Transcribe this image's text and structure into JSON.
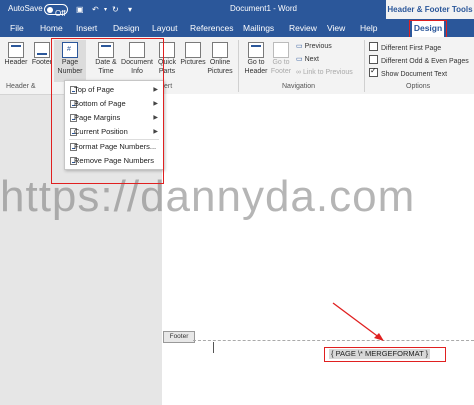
{
  "titlebar": {
    "autosave_label": "AutoSave",
    "autosave_state": "Off",
    "document_title": "Document1 - Word",
    "context_group": "Header & Footer Tools"
  },
  "tabs": [
    "File",
    "Home",
    "Insert",
    "Design",
    "Layout",
    "References",
    "Mailings",
    "Review",
    "View",
    "Help"
  ],
  "active_tab": "Design",
  "ribbon": {
    "header": "Header",
    "footer": "Footer",
    "page_number_line1": "Page",
    "page_number_line2": "Number",
    "group_header_footer": "Header &",
    "date_time_line1": "Date &",
    "date_time_line2": "Time",
    "doc_info_line1": "Document",
    "doc_info_line2": "Info",
    "quick_parts_line1": "Quick",
    "quick_parts_line2": "Parts",
    "pictures": "Pictures",
    "online_pictures_line1": "Online",
    "online_pictures_line2": "Pictures",
    "group_insert_fragment": "ert",
    "go_to_header_line1": "Go to",
    "go_to_header_line2": "Header",
    "go_to_footer_line1": "Go to",
    "go_to_footer_line2": "Footer",
    "previous": "Previous",
    "next": "Next",
    "link_previous": "Link to Previous",
    "group_navigation": "Navigation",
    "different_first_page": "Different First Page",
    "different_odd_even": "Different Odd & Even Pages",
    "show_document_text": "Show Document Text",
    "group_options": "Options"
  },
  "menu": {
    "items": [
      "Top of Page",
      "Bottom of Page",
      "Page Margins",
      "Current Position",
      "Format Page Numbers...",
      "Remove Page Numbers"
    ]
  },
  "document": {
    "watermark": "https://dannyda.com",
    "footer_label": "Footer",
    "field_code": "{ PAGE  \\* MERGEFORMAT }"
  },
  "colors": {
    "word_blue": "#2b579a",
    "highlight_red": "#e02020"
  }
}
